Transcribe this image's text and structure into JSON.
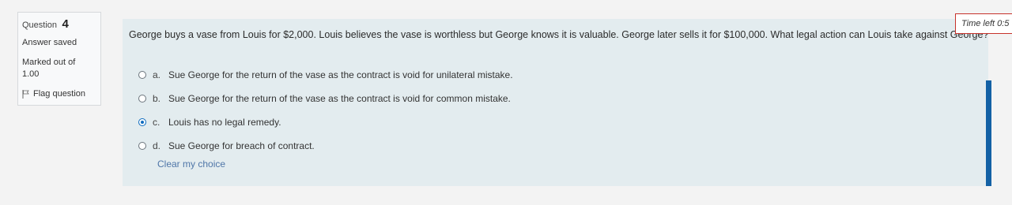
{
  "info": {
    "question_label": "Question",
    "question_number": "4",
    "state": "Answer saved",
    "marks": "Marked out of",
    "marks_value": "1.00",
    "flag_label": "Flag question"
  },
  "timer": {
    "label": "Time left 0:5"
  },
  "question": {
    "text": "George buys a vase from Louis for $2,000. Louis believes the vase is worthless but George knows it is valuable. George later sells it for $100,000. What legal action can Louis take against George?",
    "answers": [
      {
        "letter": "a.",
        "text": "Sue George for the return of the vase as the contract is void for unilateral mistake.",
        "selected": false
      },
      {
        "letter": "b.",
        "text": "Sue George for the return of the vase as the contract is void for common mistake.",
        "selected": false
      },
      {
        "letter": "c.",
        "text": "Louis has no legal remedy.",
        "selected": true
      },
      {
        "letter": "d.",
        "text": "Sue George for breach of contract.",
        "selected": false
      }
    ],
    "clear_label": "Clear my choice"
  },
  "colors": {
    "accent": "#0f6cbf",
    "timer_border": "#c7322b",
    "content_bg": "#e3ecef"
  }
}
